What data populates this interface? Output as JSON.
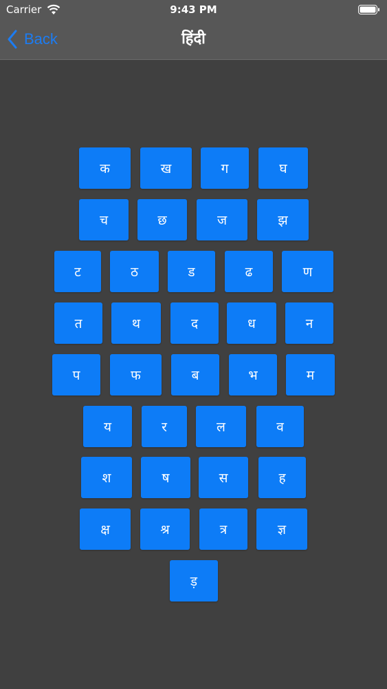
{
  "status_bar": {
    "carrier": "Carrier",
    "time": "9:43 PM"
  },
  "nav": {
    "back_label": "Back",
    "title": "हिंदी"
  },
  "keys": [
    [
      "क",
      "ख",
      "ग",
      "घ"
    ],
    [
      "च",
      "छ",
      "ज",
      "झ"
    ],
    [
      "ट",
      "ठ",
      "ड",
      "ढ",
      "ण"
    ],
    [
      "त",
      "थ",
      "द",
      "ध",
      "न"
    ],
    [
      "प",
      "फ",
      "ब",
      "भ",
      "म"
    ],
    [
      "य",
      "र",
      "ल",
      "व"
    ],
    [
      "श",
      "ष",
      "स",
      "ह"
    ],
    [
      "क्ष",
      "श्र",
      "त्र",
      "ज्ञ"
    ],
    [
      "ड़"
    ]
  ],
  "colors": {
    "background": "#404040",
    "bar": "#575757",
    "key": "#0d7cf7",
    "accent": "#1c7cf2"
  }
}
